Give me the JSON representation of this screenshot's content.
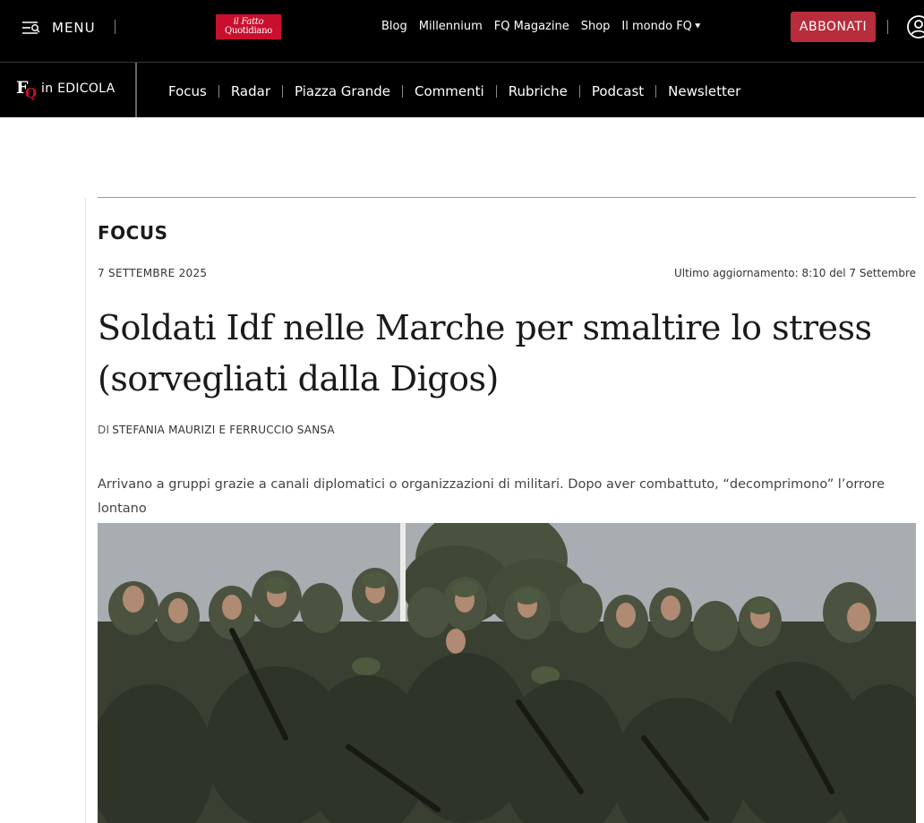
{
  "topbar": {
    "menu_label": "MENU",
    "logo_line1": "il Fatto",
    "logo_line2": "Quotidiano",
    "links": [
      "Blog",
      "Millennium",
      "FQ Magazine",
      "Shop",
      "Il mondo FQ"
    ],
    "subscribe_label": "ABBONATI",
    "icons": [
      "menu-icon",
      "chevron-down-icon",
      "user-icon"
    ]
  },
  "subnav": {
    "brand_mark": "FQ",
    "brand_text": "in EDICOLA",
    "items": [
      "Focus",
      "Radar",
      "Piazza Grande",
      "Commenti",
      "Rubriche",
      "Podcast",
      "Newsletter"
    ]
  },
  "article": {
    "section": "FOCUS",
    "date": "7 SETTEMBRE 2025",
    "updated": "Ultimo aggiornamento: 8:10 del 7 Settembre",
    "headline_line1": "Soldati Idf nelle Marche per smaltire lo stress",
    "headline_line2": "(sorvegliati dalla Digos)",
    "byline_prefix": "DI",
    "byline_authors": "STEFANIA MAURIZI E FERRUCCIO SANSA",
    "standfirst": "Arrivano a gruppi grazie a canali diplomatici o organizzazioni di militari. Dopo aver combattuto, “decomprimono” l’orrore lontano"
  },
  "colors": {
    "brand_red": "#c8102e",
    "subscribe_bg": "#b72d3b",
    "bar_bg": "#000000"
  }
}
